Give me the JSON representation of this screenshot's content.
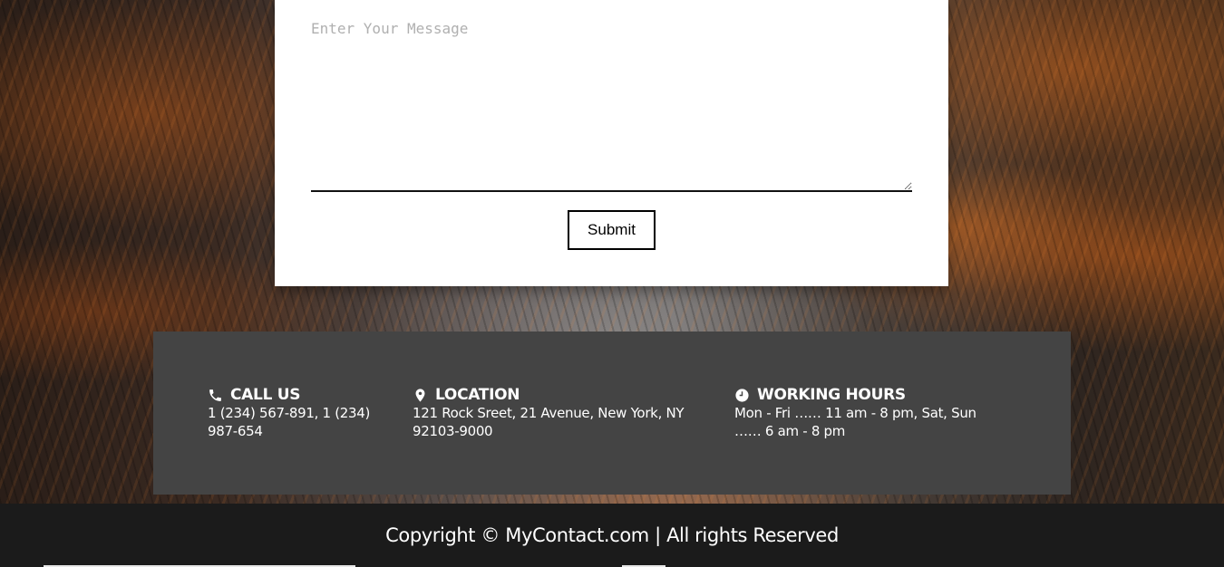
{
  "contact_form": {
    "message_placeholder": "Enter Your Message",
    "message_value": "",
    "submit_label": "Submit"
  },
  "info": {
    "call": {
      "icon": "phone-icon",
      "title": "CALL US",
      "text": "1 (234) 567-891, 1 (234) 987-654"
    },
    "location": {
      "icon": "map-pin-icon",
      "title": "LOCATION",
      "text": "121 Rock Sreet, 21 Avenue, New York, NY 92103-9000"
    },
    "hours": {
      "icon": "clock-icon",
      "title": "WORKING HOURS",
      "text": "Mon - Fri …… 11 am - 8 pm, Sat, Sun …… 6 am - 8 pm"
    }
  },
  "footer": {
    "copyright": "Copyright © MyContact.com | All rights Reserved"
  },
  "colors": {
    "panel_bg": "#444444",
    "footer_bg": "#1b1b1b",
    "card_bg": "#ffffff",
    "accent_orange": "#c8641e"
  }
}
